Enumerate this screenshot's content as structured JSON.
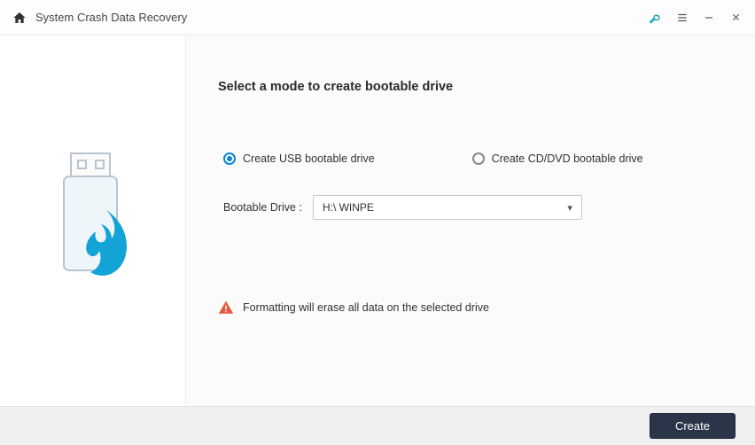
{
  "titlebar": {
    "title": "System Crash Data Recovery"
  },
  "main": {
    "heading": "Select a mode to create bootable drive",
    "options": {
      "usb": "Create USB bootable drive",
      "cd": "Create CD/DVD bootable drive",
      "selected": "usb"
    },
    "drive_label": "Bootable Drive :",
    "drive_value": "H:\\ WINPE",
    "warning": "Formatting will erase all data on the selected drive"
  },
  "footer": {
    "create": "Create"
  }
}
